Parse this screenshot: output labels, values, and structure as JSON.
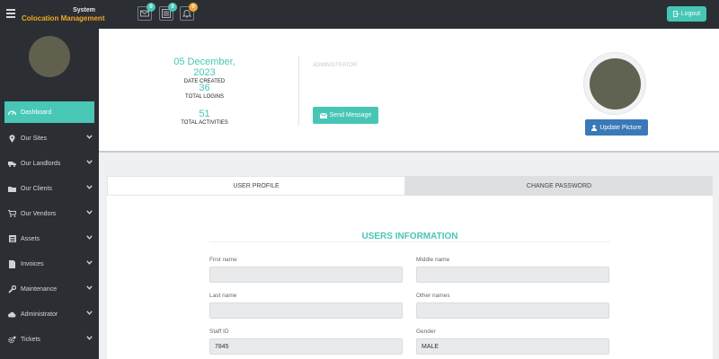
{
  "header": {
    "logo_top": "System",
    "logo_part1": "Colocation",
    "logo_part2": "Management",
    "notifications": [
      {
        "icon": "envelope-icon",
        "count": "0",
        "color": "#47c6b6"
      },
      {
        "icon": "list-icon",
        "count": "0",
        "color": "#47c6b6"
      },
      {
        "icon": "bell-icon",
        "count": "0",
        "color": "#f0a53a"
      }
    ],
    "logout_label": "Logout"
  },
  "sidebar": {
    "items": [
      {
        "label": "Dashboard",
        "icon": "dashboard-icon",
        "active": true
      },
      {
        "label": "Our Sites",
        "icon": "map-marker-icon"
      },
      {
        "label": "Our Landlords",
        "icon": "truck-icon"
      },
      {
        "label": "Our Clients",
        "icon": "folder-icon"
      },
      {
        "label": "Our Vendors",
        "icon": "cart-icon"
      },
      {
        "label": "Assets",
        "icon": "list-icon"
      },
      {
        "label": "Invoices",
        "icon": "file-icon"
      },
      {
        "label": "Maintenance",
        "icon": "wrench-icon"
      },
      {
        "label": "Administrator",
        "icon": "cloud-icon"
      },
      {
        "label": "Tickets",
        "icon": "cogs-icon"
      }
    ]
  },
  "profile": {
    "date_value": "05 December, 2023",
    "date_label": "DATE CREATED",
    "logins_value": "36",
    "logins_label": "TOTAL LOGINS",
    "activities_value": "51",
    "activities_label": "TOTAL ACTIVITIES",
    "role": "ADMINISTRATOR",
    "send_message_label": "Send Message",
    "update_picture_label": "Update Picture"
  },
  "tabs": {
    "user_profile": "USER PROFILE",
    "change_password": "CHANGE PASSWORD"
  },
  "form": {
    "title": "USERS INFORMATION",
    "first_name_label": "First name",
    "first_name_value": "",
    "middle_name_label": "Middle name",
    "middle_name_value": "",
    "last_name_label": "Last name",
    "last_name_value": "",
    "other_names_label": "Other names",
    "other_names_value": "",
    "staff_id_label": "Staff ID",
    "staff_id_value": "7845",
    "gender_label": "Gender",
    "gender_value": "MALE"
  },
  "colors": {
    "accent": "#47c6b6",
    "sidebar_bg": "#2b2f33",
    "primary_button": "#3a78b7"
  }
}
